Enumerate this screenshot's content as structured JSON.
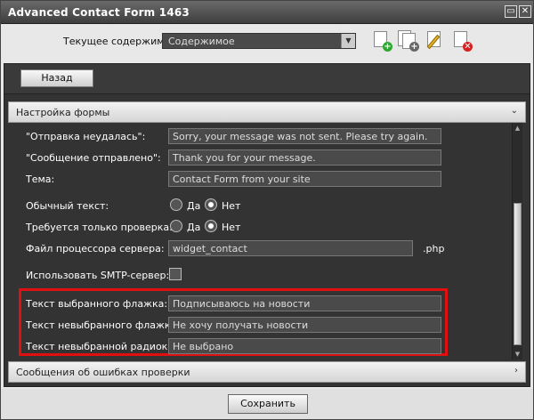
{
  "window": {
    "title": "Advanced Contact Form 1463",
    "maximize_glyph": "▭",
    "close_glyph": "✕"
  },
  "topbar": {
    "current_label": "Текущее содержимое:",
    "select_value": "Содержимое",
    "icons": [
      "add-content-icon",
      "copy-content-icon",
      "edit-content-icon",
      "delete-content-icon"
    ]
  },
  "nav": {
    "back_label": "Назад"
  },
  "sections": {
    "settings_title": "Настройка формы",
    "errors_title": "Сообщения об ошибках проверки"
  },
  "form": {
    "send_failed_label": "\"Отправка неудалась\":",
    "send_failed_value": "Sorry, your message was not sent. Please try again.",
    "sent_label": "\"Сообщение отправлено\":",
    "sent_value": "Thank you for your message.",
    "subject_label": "Тема:",
    "subject_value": "Contact Form from your site",
    "plain_text_label": "Обычный текст:",
    "only_check_label": "Требуется только проверка:",
    "yes_label": "Да",
    "no_label": "Нет",
    "plain_text_selected": "Нет",
    "only_check_selected": "Нет",
    "processor_label": "Файл процессора сервера:",
    "processor_value": "widget_contact",
    "processor_suffix": ".php",
    "smtp_label": "Использовать SMTP-сервер:",
    "smtp_checked": false,
    "checked_box_label": "Текст выбранного флажка:",
    "checked_box_value": "Подписываюсь на новости",
    "unchecked_box_label": "Текст невыбранного флажка:",
    "unchecked_box_value": "Не хочу получать новости",
    "unchecked_radio_label": "Текст невыбранной радиокнопки:",
    "unchecked_radio_value": "Не выбрано"
  },
  "footer": {
    "save_label": "Сохранить"
  },
  "colors": {
    "highlight": "#e01010",
    "panel": "#333333"
  }
}
